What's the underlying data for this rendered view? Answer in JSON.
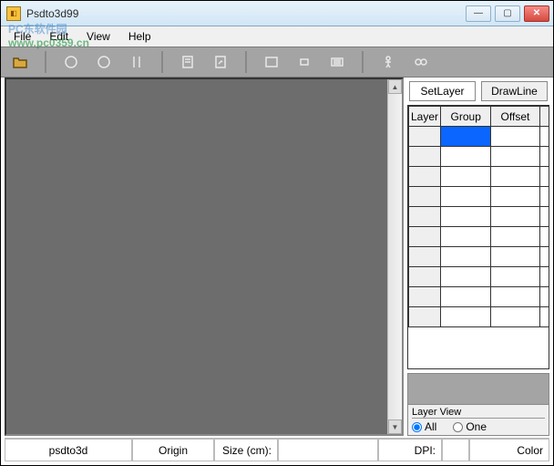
{
  "window": {
    "title": "Psdto3d99"
  },
  "menu": {
    "file": "File",
    "edit": "Edit",
    "view": "View",
    "help": "Help"
  },
  "watermark": {
    "main": "PC东软件园",
    "url": "www.pc0359.cn"
  },
  "tools": {
    "open": "open",
    "circle1": "circle",
    "circle2": "circle",
    "vbar": "vbar",
    "page": "page",
    "pagearrow": "pagearrow",
    "rect": "rect",
    "smallrect": "smallrect",
    "lines": "lines",
    "person": "person",
    "chain": "chain"
  },
  "panel": {
    "tab_setlayer": "SetLayer",
    "tab_drawline": "DrawLine",
    "columns": {
      "layer": "Layer",
      "group": "Group",
      "offset": "Offset"
    },
    "rows": 10,
    "selected": {
      "row": 0,
      "col": "group"
    },
    "layerview": {
      "title": "Layer View",
      "all": "All",
      "one": "One"
    }
  },
  "status": {
    "app": "psdto3d",
    "origin": "Origin",
    "size_label": "Size (cm):",
    "size_value": "",
    "dpi_label": "DPI:",
    "dpi_value": "",
    "color_label": "Color"
  }
}
